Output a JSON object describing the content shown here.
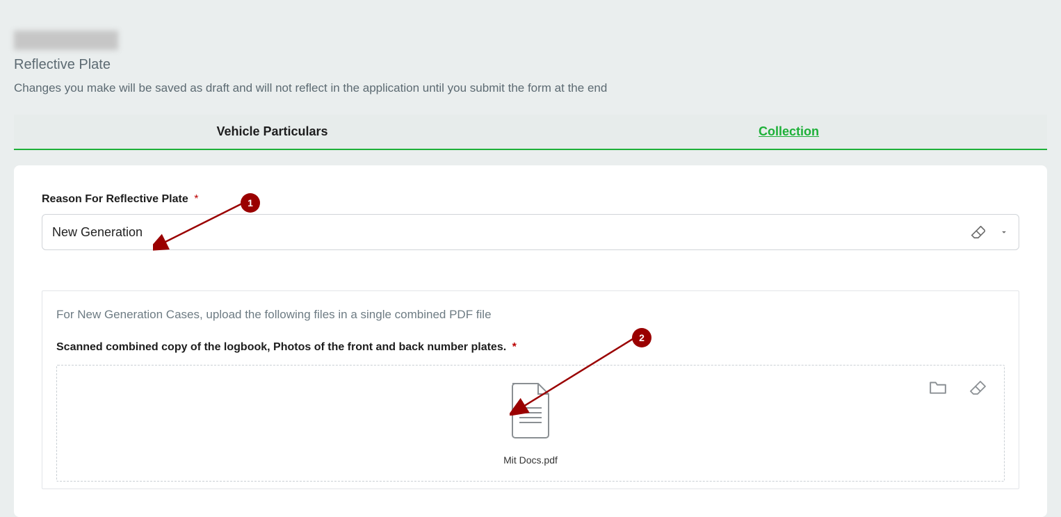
{
  "header": {
    "title": "Reflective Plate",
    "subtitle": "Changes you make will be saved as draft and will not reflect in the application until you submit the form at the end"
  },
  "tabs": {
    "left": "Vehicle Particulars",
    "right": "Collection"
  },
  "form": {
    "reason": {
      "label": "Reason For Reflective Plate",
      "required": "*",
      "value": "New Generation"
    },
    "upload": {
      "hint": "For New Generation Cases, upload the following files in a single combined PDF file",
      "label": "Scanned combined copy of the logbook, Photos of the front and back number plates.",
      "required": "*",
      "file_name": "Mit Docs.pdf"
    }
  },
  "annotations": {
    "marker1": "1",
    "marker2": "2"
  }
}
